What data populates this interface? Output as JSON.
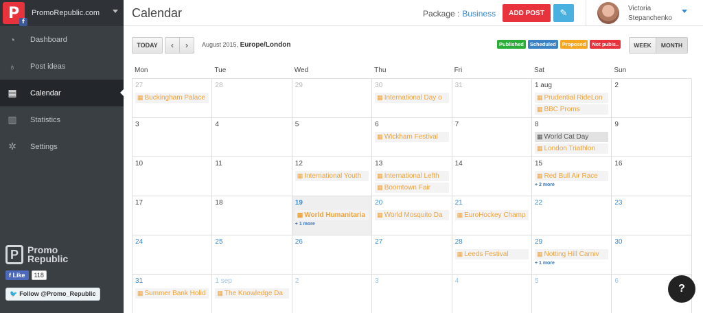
{
  "sidebar": {
    "account": "PromoRepublic.com",
    "items": [
      {
        "label": "Dashboard",
        "icon": "dashboard-icon"
      },
      {
        "label": "Post ideas",
        "icon": "lightbulb-icon"
      },
      {
        "label": "Calendar",
        "icon": "calendar-icon"
      },
      {
        "label": "Statistics",
        "icon": "bar-chart-icon"
      },
      {
        "label": "Settings",
        "icon": "gear-icon"
      }
    ],
    "brand_line1": "Promo",
    "brand_line2": "Republic",
    "fb_like": "Like",
    "fb_count": "118",
    "tw_follow": "Follow @Promo_Republic"
  },
  "header": {
    "title": "Calendar",
    "package_label": "Package :",
    "package_value": "Business",
    "add_post": "ADD POST",
    "user_first": "Victoria",
    "user_last": "Stepanchenko"
  },
  "toolbar": {
    "today": "TODAY",
    "prev": "‹",
    "next": "›",
    "range_date": "August 2015,",
    "range_tz": "Europe/London",
    "legend": [
      "Published",
      "Scheduled",
      "Proposed",
      "Not pubis.."
    ],
    "week": "WEEK",
    "month": "MONTH"
  },
  "calendar": {
    "days": [
      "Mon",
      "Tue",
      "Wed",
      "Thu",
      "Fri",
      "Sat",
      "Sun"
    ],
    "weeks": [
      [
        {
          "n": "27",
          "s": "other",
          "ev": [
            {
              "t": "Buckingham Palace"
            }
          ]
        },
        {
          "n": "28",
          "s": "other",
          "ev": []
        },
        {
          "n": "29",
          "s": "other",
          "ev": []
        },
        {
          "n": "30",
          "s": "other",
          "ev": [
            {
              "t": "International Day o"
            }
          ]
        },
        {
          "n": "31",
          "s": "other",
          "ev": []
        },
        {
          "n": "1 aug",
          "s": "",
          "ev": [
            {
              "t": "Prudential RideLon"
            },
            {
              "t": "BBC Proms"
            }
          ]
        },
        {
          "n": "2",
          "s": "",
          "ev": []
        }
      ],
      [
        {
          "n": "3",
          "s": "",
          "ev": []
        },
        {
          "n": "4",
          "s": "",
          "ev": []
        },
        {
          "n": "5",
          "s": "",
          "ev": []
        },
        {
          "n": "6",
          "s": "",
          "ev": [
            {
              "t": "Wickham Festival"
            }
          ]
        },
        {
          "n": "7",
          "s": "",
          "ev": []
        },
        {
          "n": "8",
          "s": "",
          "ev": [
            {
              "t": "World Cat Day",
              "dark": true
            },
            {
              "t": "London Triathlon"
            }
          ]
        },
        {
          "n": "9",
          "s": "",
          "ev": []
        }
      ],
      [
        {
          "n": "10",
          "s": "",
          "ev": []
        },
        {
          "n": "11",
          "s": "",
          "ev": []
        },
        {
          "n": "12",
          "s": "",
          "ev": [
            {
              "t": "International Youth"
            }
          ]
        },
        {
          "n": "13",
          "s": "",
          "ev": [
            {
              "t": "International Lefth"
            },
            {
              "t": "Boomtown Fair"
            }
          ]
        },
        {
          "n": "14",
          "s": "",
          "ev": []
        },
        {
          "n": "15",
          "s": "",
          "ev": [
            {
              "t": "Red Bull Air Race"
            }
          ],
          "more": "+ 2 more"
        },
        {
          "n": "16",
          "s": "",
          "ev": []
        }
      ],
      [
        {
          "n": "17",
          "s": "",
          "ev": []
        },
        {
          "n": "18",
          "s": "",
          "ev": []
        },
        {
          "n": "19",
          "s": "today",
          "ev": [
            {
              "t": "World Humanitaria",
              "bold": true
            }
          ],
          "more": "+ 1 more"
        },
        {
          "n": "20",
          "s": "blue",
          "ev": [
            {
              "t": "World Mosquito Da"
            }
          ]
        },
        {
          "n": "21",
          "s": "blue",
          "ev": [
            {
              "t": "EuroHockey Champ"
            }
          ]
        },
        {
          "n": "22",
          "s": "blue",
          "ev": []
        },
        {
          "n": "23",
          "s": "blue",
          "ev": []
        }
      ],
      [
        {
          "n": "24",
          "s": "blue",
          "ev": []
        },
        {
          "n": "25",
          "s": "blue",
          "ev": []
        },
        {
          "n": "26",
          "s": "blue",
          "ev": []
        },
        {
          "n": "27",
          "s": "blue",
          "ev": []
        },
        {
          "n": "28",
          "s": "blue",
          "ev": [
            {
              "t": "Leeds Festival"
            }
          ]
        },
        {
          "n": "29",
          "s": "blue",
          "ev": [
            {
              "t": "Notting Hill Carniv"
            }
          ],
          "more": "+ 1 more"
        },
        {
          "n": "30",
          "s": "blue",
          "ev": []
        }
      ],
      [
        {
          "n": "31",
          "s": "blue",
          "ev": [
            {
              "t": "Summer Bank Holid"
            }
          ]
        },
        {
          "n": "1 sep",
          "s": "paleblue",
          "ev": [
            {
              "t": "The Knowledge Da"
            }
          ]
        },
        {
          "n": "2",
          "s": "paleblue",
          "ev": []
        },
        {
          "n": "3",
          "s": "paleblue",
          "ev": []
        },
        {
          "n": "4",
          "s": "paleblue",
          "ev": []
        },
        {
          "n": "5",
          "s": "paleblue",
          "ev": []
        },
        {
          "n": "6",
          "s": "paleblue",
          "ev": []
        }
      ]
    ]
  },
  "help_label": "?"
}
